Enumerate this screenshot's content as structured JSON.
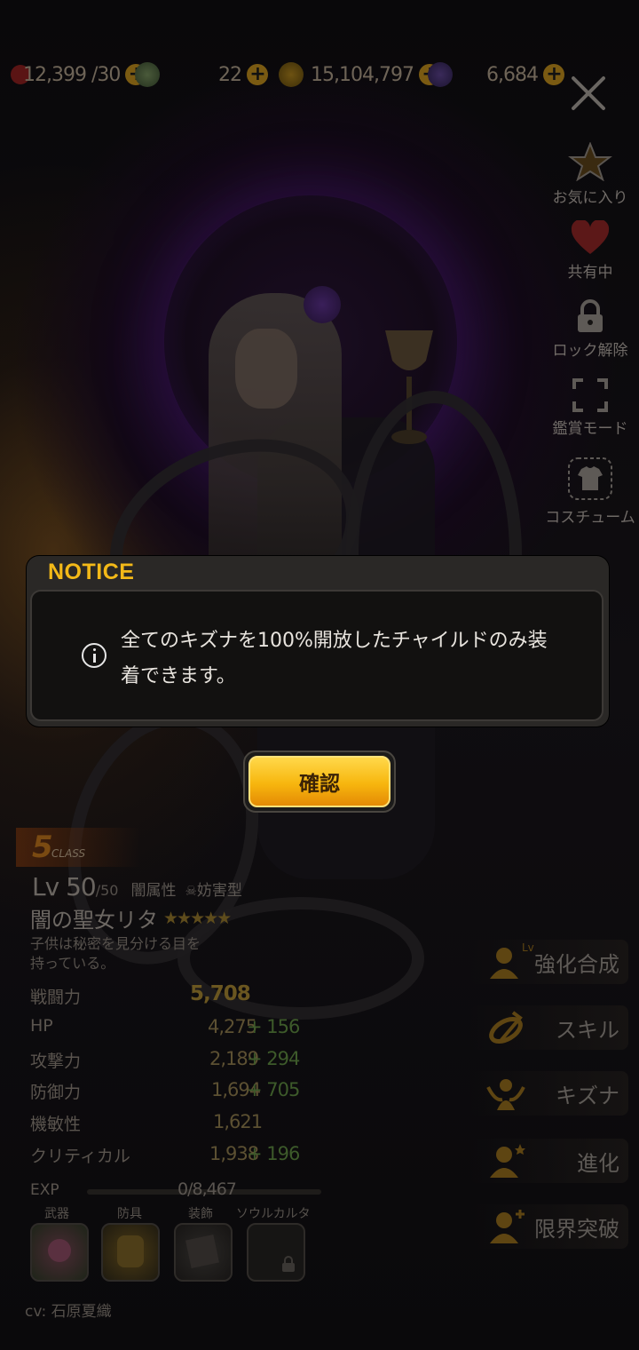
{
  "resources": {
    "stamina": "12,399 /30",
    "gems": "22",
    "gold": "15,104,797",
    "crystal": "6,684"
  },
  "side_menu": {
    "favorite": "お気に入り",
    "shared": "共有中",
    "unlock": "ロック解除",
    "viewer_mode": "鑑賞モード",
    "costume": "コスチューム"
  },
  "character": {
    "class_num": "5",
    "class_label": "CLASS",
    "level": "Lv 50",
    "level_max": "/50",
    "attribute": "闇属性",
    "role": "妨害型",
    "name": "闇の聖女リタ",
    "stars": "★★★★★",
    "description_line1": "子供は秘密を見分ける目を",
    "description_line2": "持っている。",
    "voice": "cv: 石原夏織"
  },
  "stats": {
    "combat_label": "戦闘力",
    "combat_value": "5,708",
    "rows": [
      {
        "label": "HP",
        "base": "4,275",
        "bonus": "+ 156"
      },
      {
        "label": "攻撃力",
        "base": "2,189",
        "bonus": "+ 294"
      },
      {
        "label": "防御力",
        "base": "1,694",
        "bonus": "+ 705"
      },
      {
        "label": "機敏性",
        "base": "1,621",
        "bonus": ""
      },
      {
        "label": "クリティカル",
        "base": "1,938",
        "bonus": "+ 196"
      }
    ],
    "exp_label": "EXP",
    "exp_value": "0/8,467"
  },
  "equipment": {
    "weapon": "武器",
    "armor": "防具",
    "accessory": "装飾",
    "soul_carta": "ソウルカルタ"
  },
  "actions": {
    "enhance": "強化合成",
    "skill": "スキル",
    "kizuna": "キズナ",
    "evolve": "進化",
    "limit_break": "限界突破",
    "lv_badge": "Lv"
  },
  "dialog": {
    "title": "NOTICE",
    "message": "全てのキズナを100%開放したチャイルドのみ装着できます。",
    "confirm_label": "確認"
  },
  "colors": {
    "notice_title": "#f3b918",
    "confirm_button": "#f7b60e",
    "overlay_dark": "#0b0a0c"
  }
}
